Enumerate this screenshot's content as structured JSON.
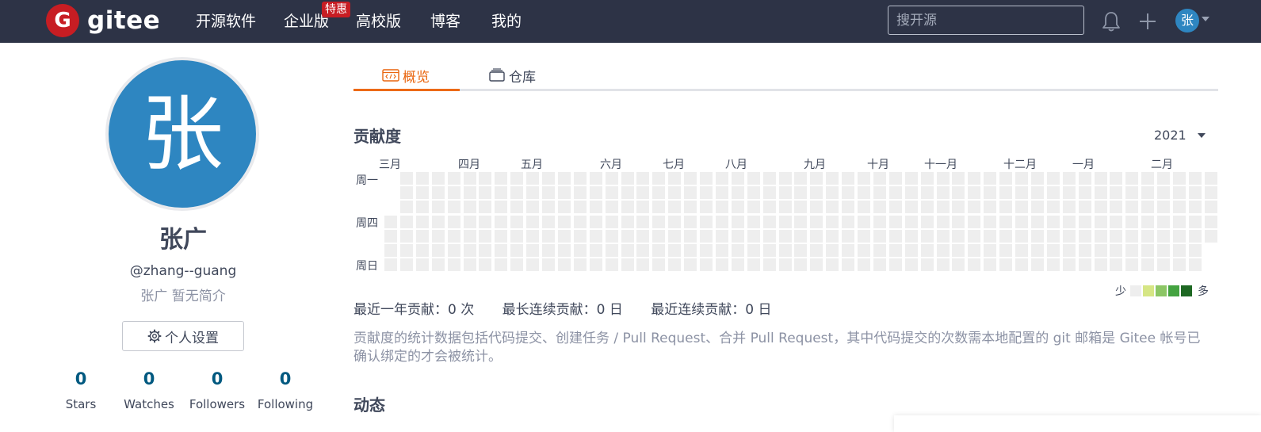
{
  "nav": {
    "brand": "gitee",
    "logo_letter": "G",
    "items": [
      {
        "label": "开源软件"
      },
      {
        "label": "企业版"
      },
      {
        "label": "高校版"
      },
      {
        "label": "博客"
      },
      {
        "label": "我的"
      }
    ],
    "enterprise_badge": "特惠",
    "search_placeholder": "搜开源",
    "user_initial": "张"
  },
  "profile": {
    "avatar_char": "张",
    "name": "张广",
    "handle": "@zhang--guang",
    "bio": "张广 暂无简介",
    "settings_button": "个人设置",
    "stats": [
      {
        "value": "0",
        "label": "Stars"
      },
      {
        "value": "0",
        "label": "Watches"
      },
      {
        "value": "0",
        "label": "Followers"
      },
      {
        "value": "0",
        "label": "Following"
      }
    ]
  },
  "tabs": [
    {
      "label": "概览",
      "active": true
    },
    {
      "label": "仓库",
      "active": false
    }
  ],
  "contribution": {
    "title": "贡献度",
    "year": "2021",
    "months": [
      "三月",
      "四月",
      "五月",
      "六月",
      "七月",
      "八月",
      "九月",
      "十月",
      "十一月",
      "十二月",
      "一月",
      "二月"
    ],
    "days": [
      "周一",
      "周四",
      "周日"
    ],
    "legend_less": "少",
    "legend_more": "多",
    "legend_colors": [
      "#eeeeee",
      "#d6e685",
      "#8cc665",
      "#44a340",
      "#1e6823"
    ],
    "empty_color": "#eeeeee",
    "summary": {
      "year_total": "最近一年贡献：0 次",
      "longest_streak": "最长连续贡献：0 日",
      "current_streak": "最近连续贡献：0 日"
    },
    "note": "贡献度的统计数据包括代码提交、创建任务 / Pull Request、合并 Pull Request，其中代码提交的次数需本地配置的 git 邮箱是 Gitee 帐号已确认绑定的才会被统计。"
  },
  "activity": {
    "title": "动态"
  },
  "colors": {
    "nav_bg": "#2d3346",
    "brand_red": "#c71d23",
    "accent_orange": "#e9650e",
    "avatar_blue": "#2e86c1",
    "stat_blue": "#005980"
  }
}
